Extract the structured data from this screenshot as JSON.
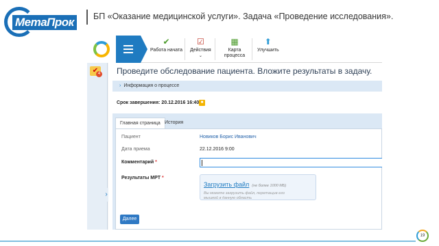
{
  "brand": {
    "logo_text": "МетаПрок",
    "accent": "#1a6fb7"
  },
  "slide": {
    "title": "БП «Оказание медицинской услуги». Задача «Проведение исследования».",
    "page_number": "19"
  },
  "toolbar": {
    "buttons": [
      {
        "label": "Работа начата",
        "icon": "check-start-icon"
      },
      {
        "label": "Действия",
        "icon": "actions-check-icon"
      },
      {
        "label": "Карта процесса",
        "icon": "process-map-icon"
      },
      {
        "label": "Улучшить",
        "icon": "improve-arrow-icon"
      }
    ]
  },
  "sidebar": {
    "task_badge": "4"
  },
  "task": {
    "title": "Проведите обследование пациента. Вложите результаты в задачу.",
    "info_label": "Информация о процессе",
    "deadline": "Срок завершения: 20.12.2016 16:40"
  },
  "tabs": [
    {
      "label": "Главная страница",
      "active": true
    },
    {
      "label": "История",
      "active": false
    }
  ],
  "form": {
    "patient_label": "Пациент",
    "patient_value": "Новиков Борис Иванович",
    "date_label": "Дата приема",
    "date_value": "22.12.2016 9:00",
    "comment_label": "Комментарий",
    "comment_value": "",
    "mri_label": "Результаты МРТ",
    "required_mark": "*",
    "upload_link": "Загрузить файл",
    "upload_limit": "(не более 1000 МБ)",
    "upload_hint": "Вы можете загрузить файл, перетащив его мышкой в данную область"
  },
  "next_button": "Далее"
}
